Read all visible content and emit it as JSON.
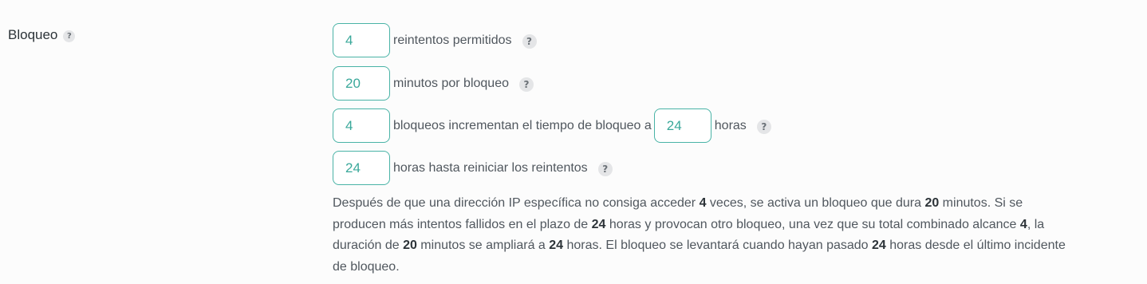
{
  "section": {
    "label": "Bloqueo",
    "help_icon": "?"
  },
  "fields": {
    "retries": {
      "value": "4",
      "label": "reintentos permitidos"
    },
    "minutes": {
      "value": "20",
      "label": "minutos por bloqueo"
    },
    "lockouts": {
      "value": "4",
      "label": "bloqueos incrementan el tiempo de bloqueo a"
    },
    "long_hours": {
      "value": "24",
      "label": "horas"
    },
    "reset_hours": {
      "value": "24",
      "label": "horas hasta reiniciar los reintentos"
    }
  },
  "help_icon": "?",
  "description": {
    "p1": "Después de que una dirección IP específica no consiga acceder ",
    "n1": "4",
    "p2": " veces, se activa un bloqueo que dura ",
    "n2": "20",
    "p3": " minutos. Si se producen más intentos fallidos en el plazo de ",
    "n3": "24",
    "p4": " horas y provocan otro bloqueo, una vez que su total combinado alcance ",
    "n4": "4",
    "p5": ", la duración de ",
    "n5": "20",
    "p6": " minutos se ampliará a ",
    "n6": "24",
    "p7": " horas. El bloqueo se levantará cuando hayan pasado ",
    "n7": "24",
    "p8": " horas desde el último incidente de bloqueo."
  }
}
